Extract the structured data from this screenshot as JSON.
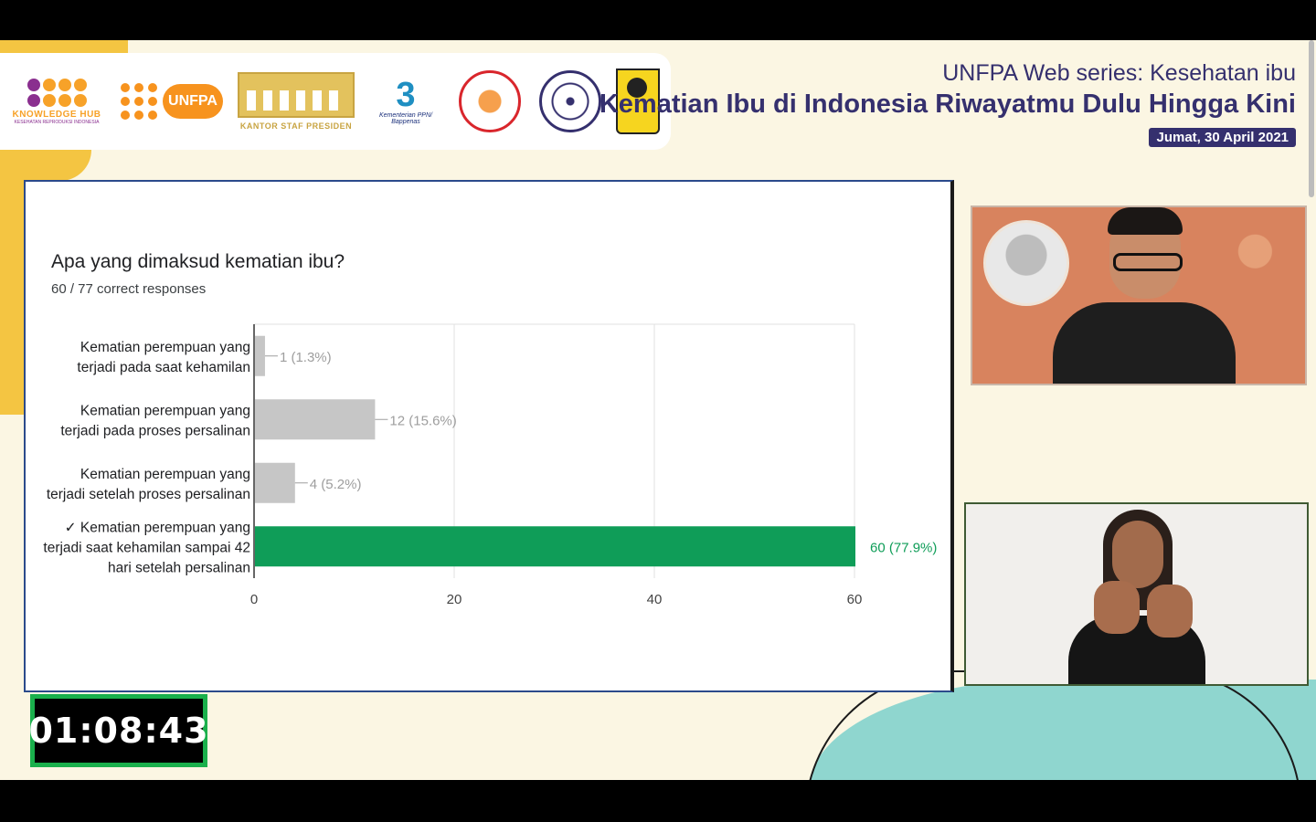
{
  "logos": {
    "knowledge_hub": {
      "name": "KNOWLEDGE HUB",
      "tagline": "KESEHATAN REPRODUKSI INDONESIA"
    },
    "unfpa": {
      "name": "UNFPA"
    },
    "ksp": {
      "name": "KANTOR STAF PRESIDEN"
    },
    "bappenas": {
      "name": "Kementerian PPN/ Bappenas"
    }
  },
  "header": {
    "series": "UNFPA Web series: Kesehatan ibu",
    "title": "Kematian Ibu di Indonesia Riwayatmu Dulu Hingga Kini",
    "date": "Jumat, 30 April 2021"
  },
  "slide": {
    "question": "Apa yang dimaksud kematian ibu?",
    "responses": "60 / 77 correct responses"
  },
  "chart_data": {
    "type": "bar",
    "orientation": "horizontal",
    "categories": [
      [
        "Kematian perempuan yang",
        "terjadi pada saat kehamilan"
      ],
      [
        "Kematian perempuan yang",
        "terjadi pada proses persalinan"
      ],
      [
        "Kematian perempuan yang",
        "terjadi setelah proses persalinan"
      ],
      [
        "✓ Kematian perempuan yang",
        "terjadi saat kehamilan sampai 42",
        "hari setelah persalinan"
      ]
    ],
    "values": [
      1,
      12,
      4,
      60
    ],
    "value_labels": [
      "1 (1.3%)",
      "12 (15.6%)",
      "4 (5.2%)",
      "60 (77.9%)"
    ],
    "correct": [
      false,
      false,
      false,
      true
    ],
    "xlim": [
      0,
      60
    ],
    "xticks": [
      0,
      20,
      40,
      60
    ],
    "colors": {
      "bar": "#c6c6c6",
      "correct": "#0f9d58",
      "label": "#9e9e9e",
      "correct_label": "#0f9d58"
    },
    "grid": true
  },
  "timer": "01:08:43"
}
